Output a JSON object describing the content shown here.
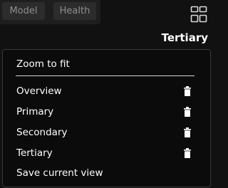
{
  "tabs": [
    {
      "label": "Model"
    },
    {
      "label": "Health"
    }
  ],
  "layout_icon": "layout-grid-icon",
  "current_view": "Tertiary",
  "menu": {
    "zoom_to_fit": "Zoom to fit",
    "views": [
      {
        "label": "Overview",
        "icon": "trash-icon"
      },
      {
        "label": "Primary",
        "icon": "trash-icon"
      },
      {
        "label": "Secondary",
        "icon": "trash-icon"
      },
      {
        "label": "Tertiary",
        "icon": "trash-icon"
      }
    ],
    "save_view": "Save current view"
  },
  "colors": {
    "background": "#111111",
    "menu_background": "#0b0b0b",
    "tab_background": "#2c2c2c",
    "tab_text": "#8f8f8f",
    "text": "#ffffff"
  }
}
